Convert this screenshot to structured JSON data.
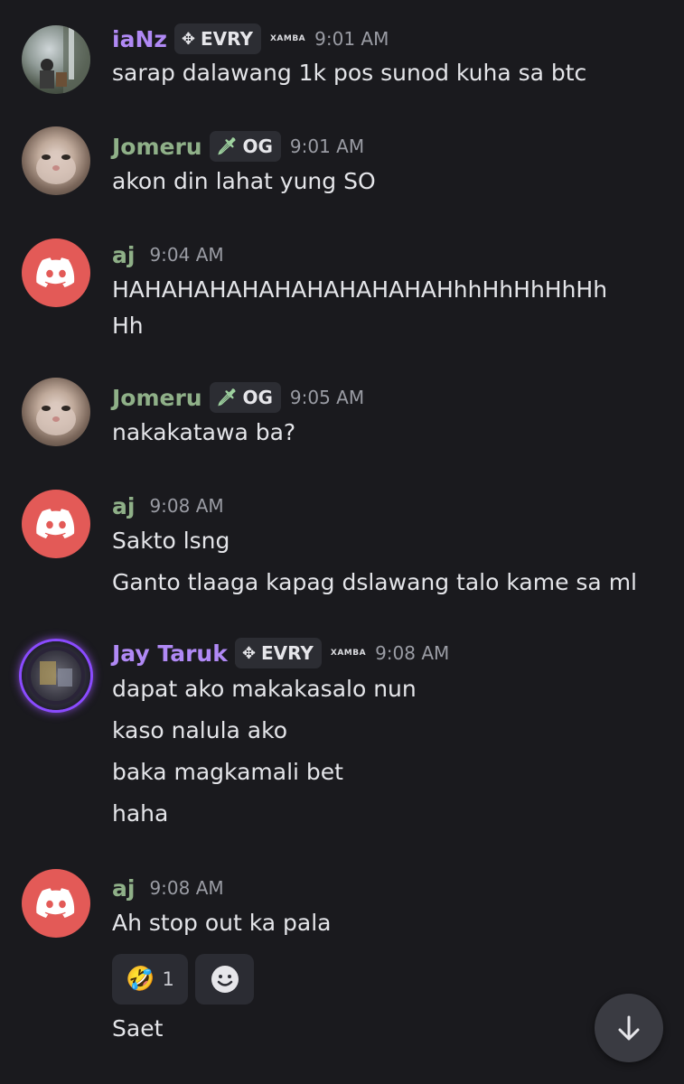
{
  "messages": [
    {
      "author": "iaNz",
      "author_color": "#b089f5",
      "tag": {
        "icon": "evry-diamond-icon",
        "label": "EVRY"
      },
      "extra": "XAMBA",
      "time": "9:01 AM",
      "avatar": "photo-avatar",
      "lines": [
        "sarap dalawang 1k pos sunod kuha sa btc"
      ]
    },
    {
      "author": "Jomeru",
      "author_color": "#8fb088",
      "tag": {
        "icon": "sword-icon",
        "label": "OG"
      },
      "time": "9:01 AM",
      "avatar": "cat-avatar",
      "lines": [
        "akon din lahat yung SO"
      ]
    },
    {
      "author": "aj",
      "author_color": "#8fb088",
      "time": "9:04 AM",
      "avatar": "discord-avatar",
      "lines": [
        "HAHAHAHAHAHAHAHAHAHAHhhHhHhHhHh",
        "Hh"
      ]
    },
    {
      "author": "Jomeru",
      "author_color": "#8fb088",
      "tag": {
        "icon": "sword-icon",
        "label": "OG"
      },
      "time": "9:05 AM",
      "avatar": "cat-avatar",
      "lines": [
        "nakakatawa ba?"
      ]
    },
    {
      "author": "aj",
      "author_color": "#8fb088",
      "time": "9:08 AM",
      "avatar": "discord-avatar",
      "lines": [
        "Sakto lsng",
        "Ganto tlaaga kapag dslawang talo kame sa ml"
      ]
    },
    {
      "author": "Jay Taruk",
      "author_color": "#b089f5",
      "tag": {
        "icon": "evry-diamond-icon",
        "label": "EVRY"
      },
      "extra": "XAMBA",
      "time": "9:08 AM",
      "avatar": "jay-avatar",
      "lines": [
        "dapat ako makakasalo nun",
        "kaso nalula ako",
        "baka magkamali bet",
        "haha"
      ]
    },
    {
      "author": "aj",
      "author_color": "#8fb088",
      "time": "9:08 AM",
      "avatar": "discord-avatar",
      "lines": [
        "Ah stop out ka pala"
      ],
      "reactions": [
        {
          "emoji": "🤣",
          "count": "1"
        },
        {
          "emoji": "add-reaction-icon",
          "count": ""
        }
      ],
      "after_lines": [
        "Saet"
      ]
    }
  ],
  "controls": {
    "scroll_to_bottom": "arrow-down-icon"
  }
}
